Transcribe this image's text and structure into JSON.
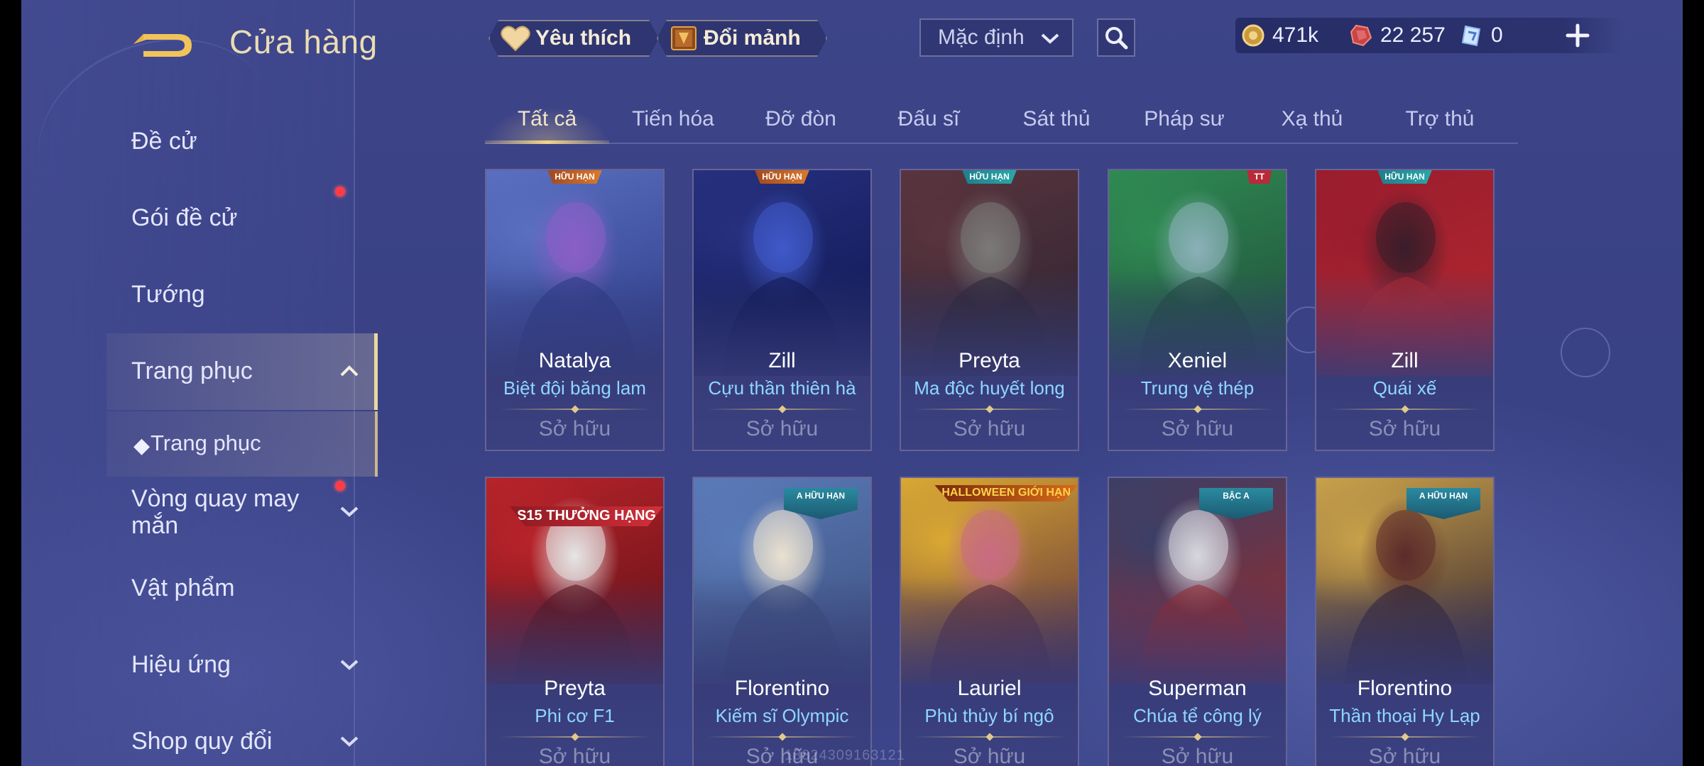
{
  "header": {
    "title": "Cửa hàng",
    "favorites_label": "Yêu thích",
    "exchange_label": "Đổi mảnh",
    "sort": {
      "selected": "Mặc định"
    },
    "currencies": [
      {
        "icon": "gold-coin-icon",
        "value": "471k"
      },
      {
        "icon": "ruby-gem-icon",
        "value": "22 257"
      },
      {
        "icon": "voucher-icon",
        "value": "0"
      }
    ]
  },
  "tabs": [
    {
      "label": "Tất cả",
      "active": true
    },
    {
      "label": "Tiến hóa",
      "active": false
    },
    {
      "label": "Đỡ đòn",
      "active": false
    },
    {
      "label": "Đấu sĩ",
      "active": false
    },
    {
      "label": "Sát thủ",
      "active": false
    },
    {
      "label": "Pháp sư",
      "active": false
    },
    {
      "label": "Xạ thủ",
      "active": false
    },
    {
      "label": "Trợ thủ",
      "active": false
    }
  ],
  "sidebar": {
    "items": [
      {
        "label": "Đề cử"
      },
      {
        "label": "Gói đề cử",
        "notification": true
      },
      {
        "label": "Tướng"
      },
      {
        "label": "Trang phục",
        "expanded": true
      },
      {
        "label": "Trang phục",
        "sub": true,
        "selected": true
      },
      {
        "label": "Vòng quay may mắn",
        "notification": true
      },
      {
        "label": "Vật phẩm"
      },
      {
        "label": "Hiệu ứng"
      },
      {
        "label": "Shop quy đổi"
      }
    ]
  },
  "cards": [
    {
      "hero": "Natalya",
      "skin": "Biệt đội băng lam",
      "status": "Sở hữu",
      "badge": "HỮU HẠN",
      "colors": [
        "#5a6fc0",
        "#8b5fc6",
        "#2b3a86"
      ]
    },
    {
      "hero": "Zill",
      "skin": "Cựu thần thiên hà",
      "status": "Sở hữu",
      "badge": "HỮU HẠN",
      "colors": [
        "#26307e",
        "#3f59c8",
        "#0e1650"
      ]
    },
    {
      "hero": "Preyta",
      "skin": "Ma độc huyết long",
      "status": "Sở hữu",
      "badge": "HỮU HẠN",
      "colors": [
        "#59343e",
        "#7a7a78",
        "#2b2430"
      ]
    },
    {
      "hero": "Xeniel",
      "skin": "Trung vệ thép",
      "status": "Sở hữu",
      "badge": "TT",
      "colors": [
        "#2f8a52",
        "#8ab0b8",
        "#1f4b3a"
      ]
    },
    {
      "hero": "Zill",
      "skin": "Quái xế",
      "status": "Sở hữu",
      "badge": "HỮU HẠN",
      "colors": [
        "#9a1d2e",
        "#3a1d2a",
        "#b3282f"
      ]
    },
    {
      "hero": "Preyta",
      "skin": "Phi cơ F1",
      "status": "Sở hữu",
      "badge": "S15 THƯỞNG HẠNG",
      "colors": [
        "#b8232a",
        "#e5e5e5",
        "#5b1016"
      ]
    },
    {
      "hero": "Florentino",
      "skin": "Kiếm sĩ Olympic",
      "status": "Sở hữu",
      "badge": "A HỮU HẠN",
      "colors": [
        "#5a7ab8",
        "#e9e0d0",
        "#3c4f7c"
      ]
    },
    {
      "hero": "Lauriel",
      "skin": "Phù thủy bí ngô",
      "status": "Sở hữu",
      "badge": "HALLOWEEN GIỚI HẠN",
      "colors": [
        "#d9a833",
        "#c86b83",
        "#5a2c3c"
      ]
    },
    {
      "hero": "Superman",
      "skin": "Chúa tể công lý",
      "status": "Sở hữu",
      "badge": "BẬC A",
      "colors": [
        "#3b3f66",
        "#d7d7de",
        "#9a2a2a"
      ]
    },
    {
      "hero": "Florentino",
      "skin": "Thần thoại Hy Lạp",
      "status": "Sở hữu",
      "badge": "A HỮU HẠN",
      "colors": [
        "#c9a14a",
        "#5b2b2b",
        "#2f2030"
      ]
    }
  ],
  "watermark": "18824309163121"
}
